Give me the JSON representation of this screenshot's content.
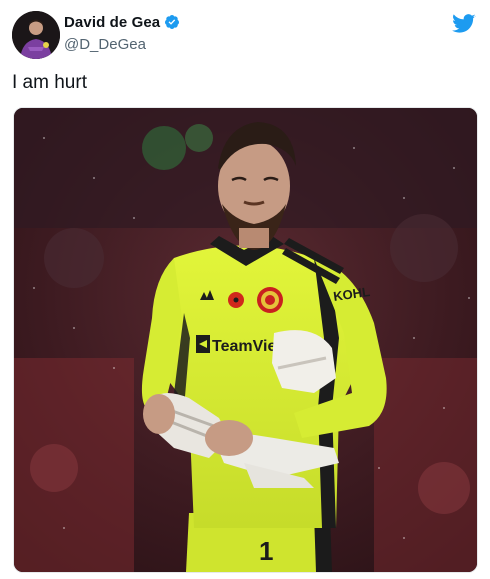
{
  "tweet": {
    "author": {
      "display_name": "David de Gea",
      "handle": "@D_DeGea",
      "verified": true,
      "avatar_icon": "profile-photo"
    },
    "text": "I am hurt",
    "platform_icon": "twitter-bird-icon",
    "photo": {
      "description_icon": "goalkeeper-photo",
      "jersey_sponsor": "TeamViewer",
      "sleeve_sponsor": "KOHLER",
      "shirt_number": "1"
    }
  },
  "colors": {
    "brand": "#1d9bf0",
    "handle": "#536471",
    "kit": "#d7f233"
  }
}
